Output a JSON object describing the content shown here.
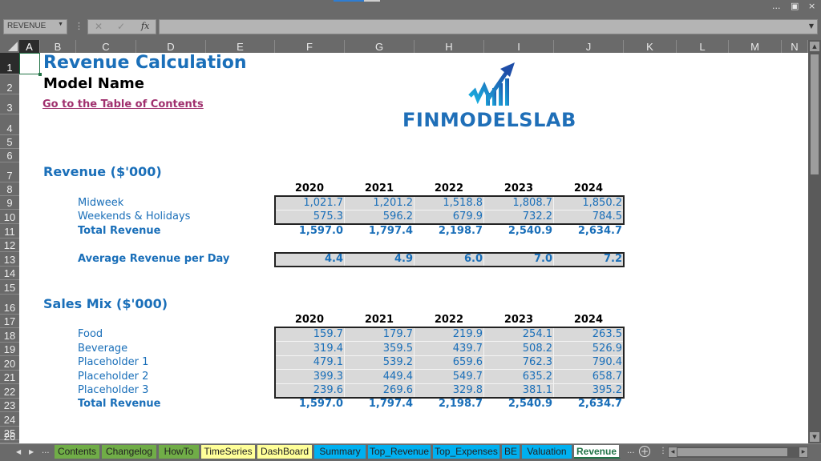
{
  "window": {
    "controls": [
      "...",
      "restore",
      "×"
    ]
  },
  "formula_bar": {
    "name_box": "REVENUE",
    "cancel_icon": "✕",
    "enter_icon": "✓",
    "fx_label": "fx",
    "formula_value": ""
  },
  "columns": [
    "A",
    "B",
    "C",
    "D",
    "E",
    "F",
    "G",
    "H",
    "I",
    "J",
    "K",
    "L",
    "M",
    "N"
  ],
  "rows": [
    "1",
    "2",
    "3",
    "4",
    "5",
    "6",
    "7",
    "8",
    "9",
    "10",
    "11",
    "12",
    "13",
    "14",
    "15",
    "16",
    "17",
    "18",
    "19",
    "20",
    "21",
    "22",
    "23",
    "24",
    "25",
    "26"
  ],
  "sheet": {
    "title": "Revenue Calculation",
    "model_name": "Model Name",
    "toc_link": "Go to the Table of Contents",
    "logo_text": "FINMODELSLAB",
    "revenue_section": {
      "heading": "Revenue ($'000)",
      "years": [
        "2020",
        "2021",
        "2022",
        "2023",
        "2024"
      ],
      "rows": [
        {
          "label": "Midweek",
          "values": [
            "1,021.7",
            "1,201.2",
            "1,518.8",
            "1,808.7",
            "1,850.2"
          ]
        },
        {
          "label": "Weekends & Holidays",
          "values": [
            "575.3",
            "596.2",
            "679.9",
            "732.2",
            "784.5"
          ]
        }
      ],
      "total": {
        "label": "Total Revenue",
        "values": [
          "1,597.0",
          "1,797.4",
          "2,198.7",
          "2,540.9",
          "2,634.7"
        ]
      },
      "average": {
        "label": "Average Revenue per Day",
        "values": [
          "4.4",
          "4.9",
          "6.0",
          "7.0",
          "7.2"
        ]
      }
    },
    "sales_mix_section": {
      "heading": "Sales Mix ($'000)",
      "years": [
        "2020",
        "2021",
        "2022",
        "2023",
        "2024"
      ],
      "rows": [
        {
          "label": "Food",
          "values": [
            "159.7",
            "179.7",
            "219.9",
            "254.1",
            "263.5"
          ]
        },
        {
          "label": "Beverage",
          "values": [
            "319.4",
            "359.5",
            "439.7",
            "508.2",
            "526.9"
          ]
        },
        {
          "label": "Placeholder 1",
          "values": [
            "479.1",
            "539.2",
            "659.6",
            "762.3",
            "790.4"
          ]
        },
        {
          "label": "Placeholder 2",
          "values": [
            "399.3",
            "449.4",
            "549.7",
            "635.2",
            "658.7"
          ]
        },
        {
          "label": "Placeholder 3",
          "values": [
            "239.6",
            "269.6",
            "329.8",
            "381.1",
            "395.2"
          ]
        }
      ],
      "total": {
        "label": "Total Revenue",
        "values": [
          "1,597.0",
          "1,797.4",
          "2,198.7",
          "2,540.9",
          "2,634.7"
        ]
      }
    }
  },
  "sheet_tabs": [
    {
      "label": "Contents",
      "color": "#70ad47"
    },
    {
      "label": "Changelog",
      "color": "#70ad47"
    },
    {
      "label": "HowTo",
      "color": "#70ad47"
    },
    {
      "label": "TimeSeries",
      "color": "#ffff99"
    },
    {
      "label": "DashBoard",
      "color": "#ffff99"
    },
    {
      "label": "Summary",
      "color": "#00b0f0"
    },
    {
      "label": "Top_Revenue",
      "color": "#00b0f0"
    },
    {
      "label": "Top_Expenses",
      "color": "#00b0f0"
    },
    {
      "label": "BE",
      "color": "#00b0f0"
    },
    {
      "label": "Valuation",
      "color": "#00b0f0"
    },
    {
      "label": "Revenue",
      "color": "#ffffff",
      "active": true
    }
  ],
  "tab_nav": {
    "prev": "◀",
    "next": "▶",
    "more": "...",
    "more_right": "...",
    "add": "+"
  }
}
